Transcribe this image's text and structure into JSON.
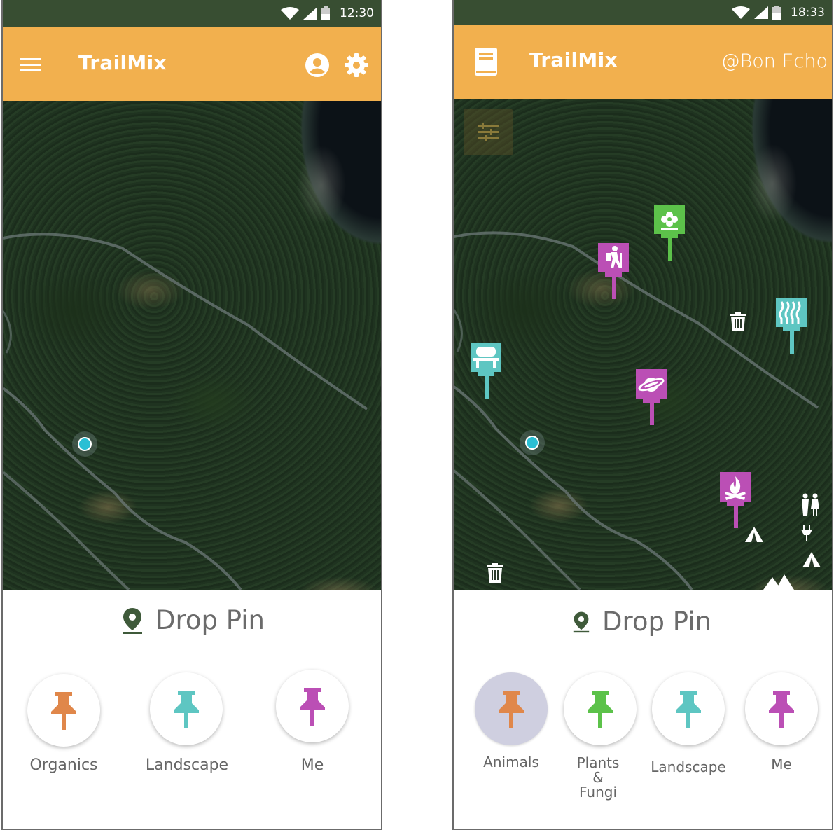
{
  "phone1": {
    "status": {
      "time": "12:30"
    },
    "appbar": {
      "title": "TrailMix",
      "menu_icon": "menu-icon",
      "account_icon": "account-circle-icon",
      "settings_icon": "gear-icon"
    },
    "drop_pin": {
      "label": "Drop Pin"
    },
    "categories": [
      {
        "label": "Organics",
        "color": "#e0874a"
      },
      {
        "label": "Landscape",
        "color": "#5ec6c2"
      },
      {
        "label": "Me",
        "color": "#bb4fb5"
      }
    ]
  },
  "phone2": {
    "status": {
      "time": "18:33"
    },
    "appbar": {
      "title": "TrailMix",
      "handle": "@Bon Echo",
      "book_icon": "book-icon"
    },
    "drop_pin": {
      "label": "Drop Pin"
    },
    "categories": [
      {
        "label": "Animals",
        "color": "#e0874a",
        "selected": true
      },
      {
        "label": "Plants & Fungi",
        "label_lines": [
          "Plants",
          "&",
          "Fungi"
        ],
        "color": "#5cc24a"
      },
      {
        "label": "Landscape",
        "color": "#5ec6c2"
      },
      {
        "label": "Me",
        "color": "#bb4fb5"
      }
    ],
    "map_pins": [
      {
        "icon": "flower-icon",
        "color": "#5cc24a"
      },
      {
        "icon": "hiker-icon",
        "color": "#bb4fb5"
      },
      {
        "icon": "waterfall-icon",
        "color": "#5ec6c2"
      },
      {
        "icon": "bench-icon",
        "color": "#5ec6c2"
      },
      {
        "icon": "planet-icon",
        "color": "#bb4fb5"
      },
      {
        "icon": "campfire-icon",
        "color": "#bb4fb5"
      }
    ],
    "map_markers": [
      "trash-icon",
      "trash-icon",
      "restroom-icon",
      "outlet-icon",
      "tent-icon",
      "tent-icon",
      "tent-icon"
    ]
  }
}
